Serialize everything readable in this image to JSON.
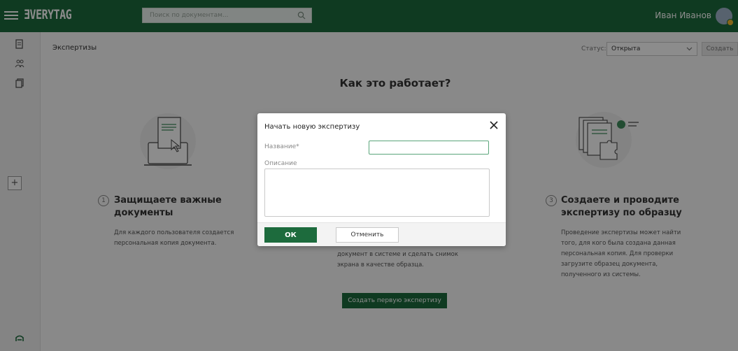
{
  "header": {
    "logo": "ƎVERYTAG",
    "search_placeholder": "Поиск по документам...",
    "user_name": "Иван Иванов"
  },
  "page": {
    "breadcrumb": "Экспертизы",
    "status_label": "Статус:",
    "status_value": "Открыта",
    "create_label": "Создать",
    "how_title": "Как это работает?",
    "cta_label": "Создать первую экспертизу"
  },
  "steps": [
    {
      "num": "1",
      "title_line1": "Защищаете важные",
      "title_line2": "документы",
      "desc_line1": "Для каждого пользователя создается",
      "desc_line2": "персональная копия документа."
    },
    {
      "desc_line1": "документ в системе и сделать снимок",
      "desc_line2": "экрана в качестве образца."
    },
    {
      "num": "3",
      "title_line1": "Создаете и проводите",
      "title_line2": "экспертизу по образцу",
      "desc_line1": "Проведение экспертизы может найти",
      "desc_line2": "того, для кого была создана данная",
      "desc_line3": "персональная копия. Для проверки",
      "desc_line4": "загрузите образец документа,",
      "desc_line5": "полученного из системы."
    }
  ],
  "modal": {
    "title": "Начать новую экспертизу",
    "name_label": "Название*",
    "name_value": "",
    "desc_label": "Описание",
    "desc_value": "",
    "ok_label": "ОК",
    "cancel_label": "Отменить"
  },
  "colors": {
    "brand_green": "#1d6b3d",
    "overlay": "rgba(0,0,0,0.45)"
  },
  "icons": {
    "menu": "hamburger-icon",
    "search": "search-icon",
    "sidebar": [
      "documents-icon",
      "users-icon",
      "copy-icon",
      "plus-icon"
    ],
    "bottom": "brand-mark-icon",
    "close": "close-icon",
    "chevron": "chevron-down-icon"
  }
}
